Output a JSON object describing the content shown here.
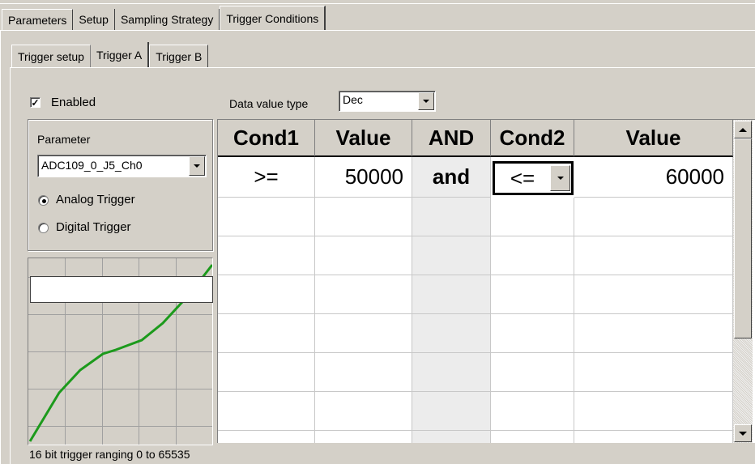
{
  "top_tabs": [
    "Parameters",
    "Setup",
    "Sampling Strategy",
    "Trigger Conditions"
  ],
  "sub_tabs": [
    "Trigger setup",
    "Trigger A",
    "Trigger B"
  ],
  "enabled": {
    "label": "Enabled",
    "checked": true,
    "check_glyph": "✓"
  },
  "parameter": {
    "label": "Parameter",
    "value": "ADC109_0_J5_Ch0"
  },
  "analog_trigger": {
    "label": "Analog Trigger",
    "selected": true
  },
  "digital_trigger": {
    "label": "Digital Trigger",
    "selected": false
  },
  "data_value_type": {
    "label": "Data value type",
    "value": "Dec"
  },
  "grid": {
    "headers": [
      "Cond1",
      "Value",
      "AND",
      "Cond2",
      "Value"
    ],
    "row1": {
      "cond1": ">=",
      "value1": "50000",
      "and": "and",
      "cond2": "<=",
      "value2": "60000"
    }
  },
  "status_text": "16 bit trigger ranging 0 to 65535",
  "icons": [
    "dropdown-arrow-icon",
    "scroll-up-arrow-icon",
    "scroll-down-arrow-icon",
    "checkmark-icon"
  ]
}
